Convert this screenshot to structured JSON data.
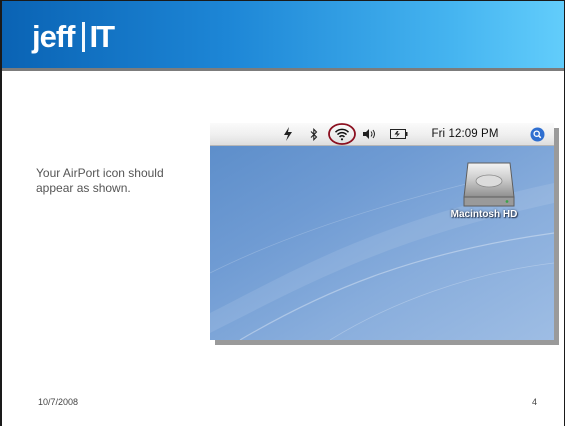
{
  "logo": {
    "brand_left": "jeff",
    "brand_right": "IT"
  },
  "body": {
    "caption": "Your AirPort icon should appear as shown."
  },
  "footer": {
    "date": "10/7/2008",
    "page_number": "4"
  },
  "screenshot": {
    "menubar": {
      "icons": [
        "sync-icon",
        "bluetooth-icon",
        "airport-wifi-icon",
        "volume-icon",
        "battery-icon",
        "spotlight-icon"
      ],
      "clock": "Fri 12:09 PM"
    },
    "desktop_icon_label": "Macintosh HD",
    "highlight_color": "#8b0f1f"
  },
  "colors": {
    "header_start": "#0a63b4",
    "header_end": "#62cdfb"
  }
}
